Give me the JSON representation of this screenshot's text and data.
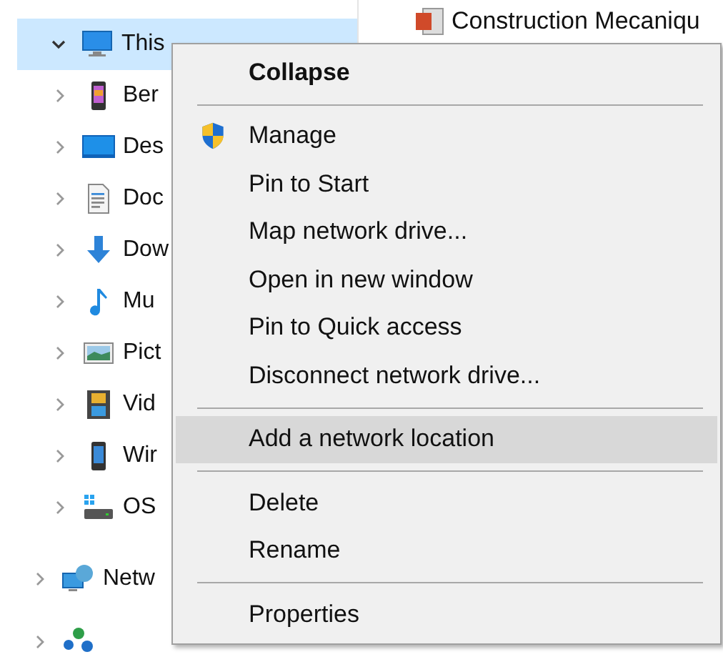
{
  "nav_tree": [
    {
      "label": "This",
      "expanded": true,
      "selected": true,
      "children": [
        {
          "label": "Ber",
          "expanded": false,
          "selected": false
        },
        {
          "label": "Des",
          "expanded": false,
          "selected": false
        },
        {
          "label": "Doc",
          "expanded": false,
          "selected": false
        },
        {
          "label": "Dow",
          "expanded": false,
          "selected": false
        },
        {
          "label": "Mu",
          "expanded": false,
          "selected": false
        },
        {
          "label": "Pict",
          "expanded": false,
          "selected": false
        },
        {
          "label": "Vid",
          "expanded": false,
          "selected": false
        },
        {
          "label": "Wir",
          "expanded": false,
          "selected": false
        },
        {
          "label": "OS",
          "expanded": false,
          "selected": false
        }
      ]
    },
    {
      "label": "Netw",
      "expanded": false,
      "selected": false
    },
    {
      "expanded": false,
      "selected": false
    }
  ],
  "file_list": [
    {
      "name": "Construction Mecaniqu"
    }
  ],
  "context_menu": [
    {
      "kind": "item",
      "label": "Collapse",
      "bold": true,
      "highlighted": false
    },
    {
      "kind": "separator"
    },
    {
      "kind": "item",
      "label": "Manage",
      "shield": true,
      "highlighted": false
    },
    {
      "kind": "item",
      "label": "Pin to Start",
      "highlighted": false
    },
    {
      "kind": "item",
      "label": "Map network drive...",
      "highlighted": false
    },
    {
      "kind": "item",
      "label": "Open in new window",
      "highlighted": false
    },
    {
      "kind": "item",
      "label": "Pin to Quick access",
      "highlighted": false
    },
    {
      "kind": "item",
      "label": "Disconnect network drive...",
      "highlighted": false
    },
    {
      "kind": "separator"
    },
    {
      "kind": "item",
      "label": "Add a network location",
      "highlighted": true
    },
    {
      "kind": "separator"
    },
    {
      "kind": "item",
      "label": "Delete",
      "highlighted": false
    },
    {
      "kind": "item",
      "label": "Rename",
      "highlighted": false
    },
    {
      "kind": "separator"
    },
    {
      "kind": "item",
      "label": "Properties",
      "highlighted": false
    }
  ]
}
